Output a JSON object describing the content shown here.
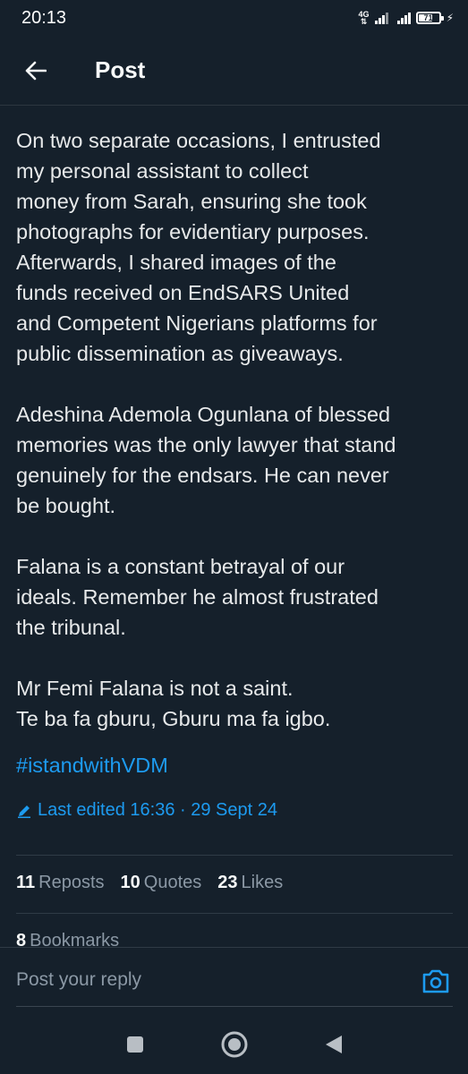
{
  "status_bar": {
    "time": "20:13",
    "network": "4G",
    "battery_level": "71",
    "battery_fraction": 0.71
  },
  "header": {
    "title": "Post",
    "back_icon": "arrow-left-icon"
  },
  "post": {
    "paragraphs": [
      [
        "On two separate occasions, I entrusted",
        "my personal assistant to collect",
        "money from Sarah, ensuring she took",
        "photographs for evidentiary purposes.",
        "Afterwards, I shared images of the",
        "funds received on EndSARS United",
        "and Competent Nigerians platforms for",
        "public dissemination as giveaways."
      ],
      [
        "Adeshina Ademola Ogunlana of blessed",
        "memories was the only lawyer that stand",
        "genuinely for the endsars. He can never",
        "be bought."
      ],
      [
        "Falana is a constant betrayal of our",
        "ideals. Remember he almost frustrated",
        "the tribunal."
      ],
      [
        "Mr Femi Falana is not a saint.",
        "Te ba fa gburu, Gburu ma fa igbo."
      ]
    ],
    "hashtag": "#istandwithVDM",
    "edited": "Last edited 16:36 · 29 Sept 24"
  },
  "stats": {
    "reposts_count": "11",
    "reposts_label": "Reposts",
    "quotes_count": "10",
    "quotes_label": "Quotes",
    "likes_count": "23",
    "likes_label": "Likes",
    "bookmarks_count": "8",
    "bookmarks_label": "Bookmarks"
  },
  "reply": {
    "placeholder": "Post your reply"
  },
  "colors": {
    "background": "#15202b",
    "accent": "#1d9bf0",
    "text": "#e7e9ea",
    "muted": "#8b98a5"
  }
}
